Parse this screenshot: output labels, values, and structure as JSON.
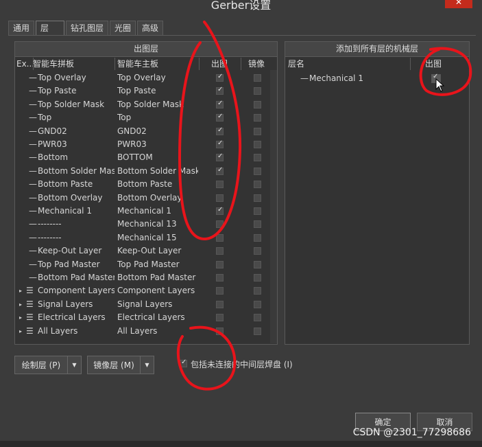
{
  "window": {
    "title": "Gerber设置",
    "close_glyph": "✕"
  },
  "tabs": [
    "通用",
    "层",
    "钻孔图层",
    "光圈",
    "高级"
  ],
  "left_panel": {
    "title": "出图层",
    "columns": [
      "Ex...",
      "智能车拼板",
      "智能车主板",
      "出图",
      "镜像"
    ],
    "rows": [
      {
        "ex": "",
        "a": "Top Overlay",
        "b": "Top Overlay",
        "plot": true,
        "mirror": false
      },
      {
        "ex": "",
        "a": "Top Paste",
        "b": "Top Paste",
        "plot": true,
        "mirror": false
      },
      {
        "ex": "",
        "a": "Top Solder Mask",
        "b": "Top Solder Mask",
        "plot": true,
        "mirror": false
      },
      {
        "ex": "",
        "a": "Top",
        "b": "Top",
        "plot": true,
        "mirror": false
      },
      {
        "ex": "",
        "a": "GND02",
        "b": "GND02",
        "plot": true,
        "mirror": false
      },
      {
        "ex": "",
        "a": "PWR03",
        "b": "PWR03",
        "plot": true,
        "mirror": false
      },
      {
        "ex": "",
        "a": "Bottom",
        "b": "BOTTOM",
        "plot": true,
        "mirror": false
      },
      {
        "ex": "",
        "a": "Bottom Solder Mask",
        "b": "Bottom Solder Mask",
        "plot": true,
        "mirror": false
      },
      {
        "ex": "",
        "a": "Bottom Paste",
        "b": "Bottom Paste",
        "plot": false,
        "mirror": false
      },
      {
        "ex": "",
        "a": "Bottom Overlay",
        "b": "Bottom Overlay",
        "plot": false,
        "mirror": false
      },
      {
        "ex": "",
        "a": "Mechanical 1",
        "b": "Mechanical 1",
        "plot": true,
        "mirror": false
      },
      {
        "ex": "",
        "a": "--------",
        "b": "Mechanical 13",
        "plot": false,
        "mirror": false
      },
      {
        "ex": "",
        "a": "--------",
        "b": "Mechanical 15",
        "plot": false,
        "mirror": false
      },
      {
        "ex": "",
        "a": "Keep-Out Layer",
        "b": "Keep-Out Layer",
        "plot": false,
        "mirror": false
      },
      {
        "ex": "",
        "a": "Top Pad Master",
        "b": "Top Pad Master",
        "plot": false,
        "mirror": false
      },
      {
        "ex": "",
        "a": "Bottom Pad Master",
        "b": "Bottom Pad Master",
        "plot": false,
        "mirror": false
      },
      {
        "ex": "▸",
        "a": "Component Layers",
        "b": "Component Layers",
        "plot": false,
        "mirror": false,
        "group": true
      },
      {
        "ex": "▸",
        "a": "Signal Layers",
        "b": "Signal Layers",
        "plot": false,
        "mirror": false,
        "group": true
      },
      {
        "ex": "▸",
        "a": "Electrical Layers",
        "b": "Electrical Layers",
        "plot": false,
        "mirror": false,
        "group": true
      },
      {
        "ex": "▸",
        "a": "All Layers",
        "b": "All Layers",
        "plot": false,
        "mirror": false,
        "group": true
      }
    ]
  },
  "right_panel": {
    "title": "添加到所有层的机械层",
    "columns": [
      "层名",
      "出图"
    ],
    "rows": [
      {
        "name": "Mechanical 1",
        "plot": true
      }
    ]
  },
  "buttons": {
    "plot_layers": "绘制层 (P)",
    "mirror_layers": "镜像层 (M)",
    "ok": "确定",
    "cancel": "取消"
  },
  "option": {
    "label": "包括未连接的中间层焊盘 (I)",
    "checked": true
  },
  "watermark": "CSDN @2301_77298686",
  "colors": {
    "annotation": "#e8141b",
    "background": "#3b3b3b"
  }
}
